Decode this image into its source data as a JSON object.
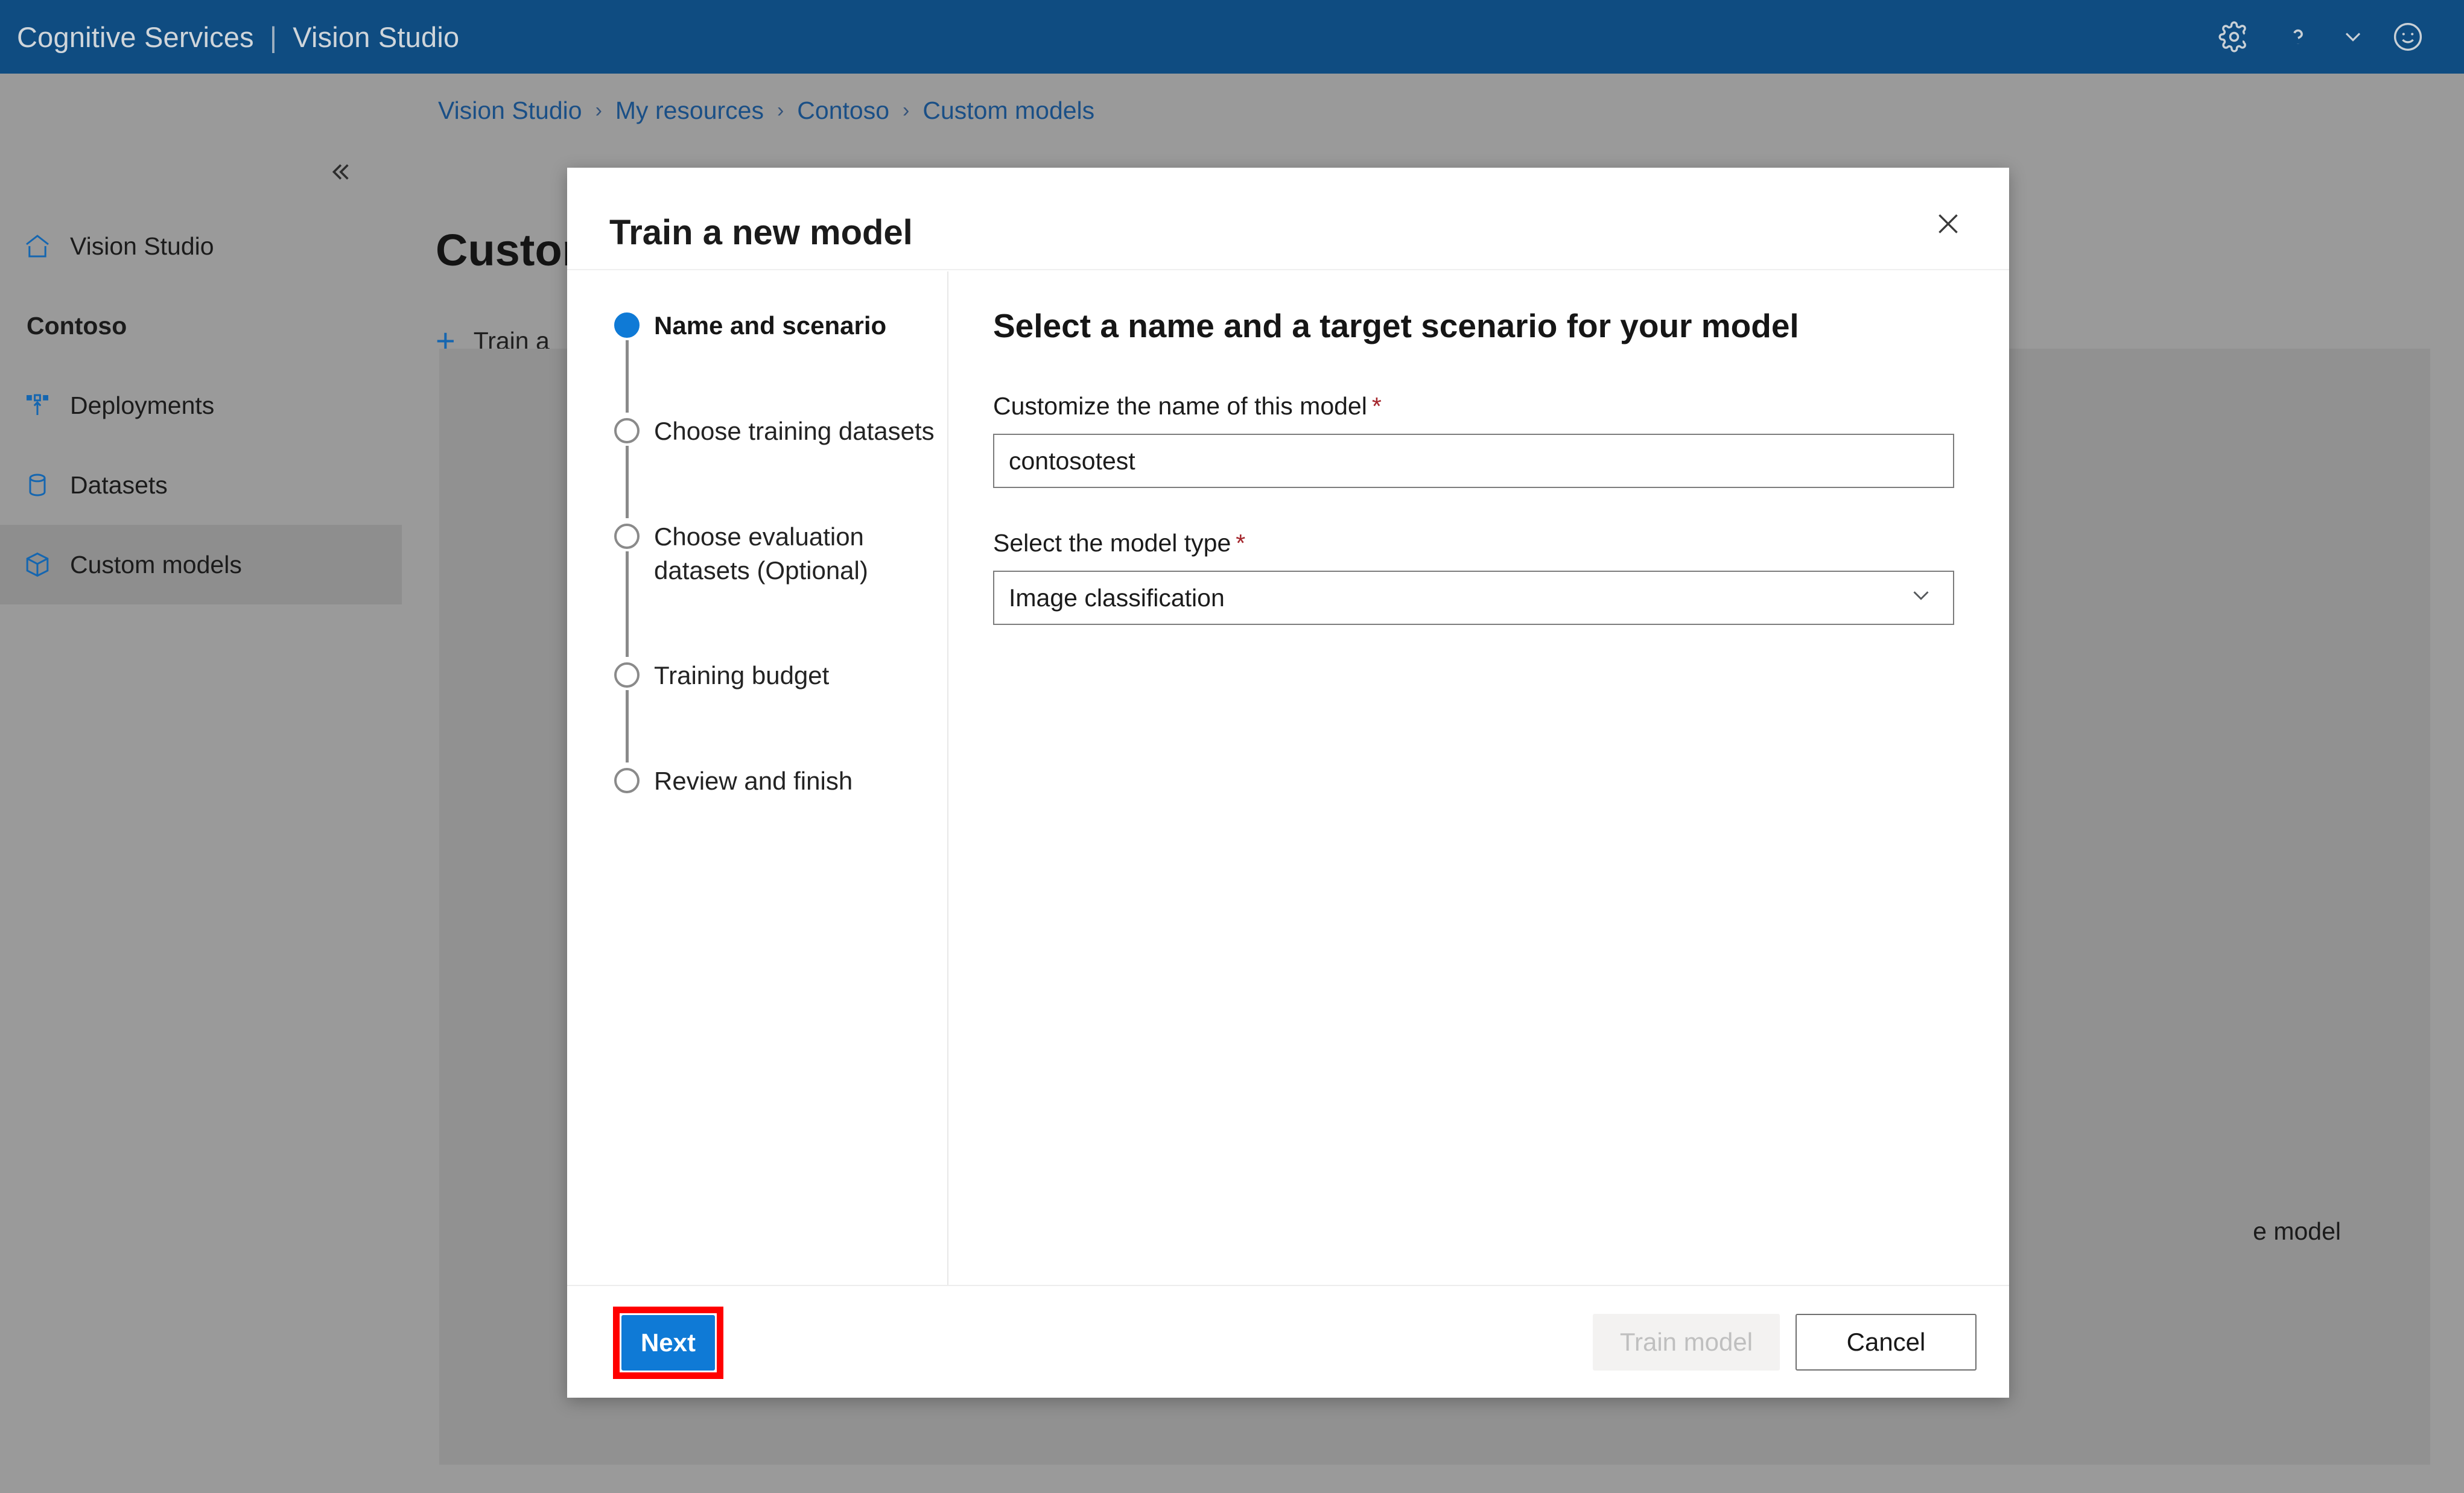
{
  "header": {
    "brand_primary": "Cognitive Services",
    "brand_separator": "|",
    "brand_secondary": "Vision Studio",
    "icons": {
      "settings": "gear-icon",
      "help": "question-icon",
      "help_chevron": "chevron-down-icon",
      "feedback": "smiley-face-icon"
    },
    "background_color": "#0f4c81"
  },
  "sidebar": {
    "collapse_label": "«",
    "home_item": {
      "label": "Vision Studio",
      "icon": "home-icon"
    },
    "group_title": "Contoso",
    "items": [
      {
        "label": "Deployments",
        "icon": "deployments-icon",
        "selected": false
      },
      {
        "label": "Datasets",
        "icon": "database-icon",
        "selected": false
      },
      {
        "label": "Custom models",
        "icon": "box-icon",
        "selected": true
      }
    ],
    "background_color": "#9a9a9a",
    "selected_color": "#8e8e8e",
    "icon_color": "#1566b0"
  },
  "main": {
    "breadcrumb": [
      "Vision Studio",
      "My resources",
      "Contoso",
      "Custom models"
    ],
    "breadcrumb_separator": "›",
    "page_title": "Custom models",
    "command_bar": {
      "plus": "+",
      "label": "Train a"
    },
    "card_partial_text": "e model"
  },
  "modal": {
    "title": "Train a new model",
    "close_icon": "close-icon",
    "steps": [
      {
        "label": "Name and scenario",
        "active": true
      },
      {
        "label": "Choose training datasets",
        "active": false
      },
      {
        "label": "Choose evaluation datasets (Optional)",
        "active": false
      },
      {
        "label": "Training budget",
        "active": false
      },
      {
        "label": "Review and finish",
        "active": false
      }
    ],
    "form": {
      "heading": "Select a name and a target scenario for your model",
      "name_field": {
        "label": "Customize the name of this model",
        "required_mark": "*",
        "value": "contosotest"
      },
      "model_type_field": {
        "label": "Select the model type",
        "required_mark": "*",
        "value": "Image classification",
        "chevron_icon": "chevron-down-icon"
      }
    },
    "footer": {
      "next_label": "Next",
      "train_label": "Train model",
      "cancel_label": "Cancel"
    },
    "accent_color": "#0f7ad6",
    "highlight_color": "#ff0000"
  }
}
